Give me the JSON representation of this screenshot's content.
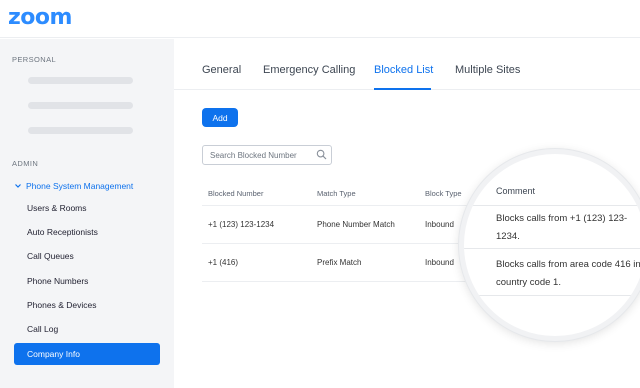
{
  "app": {
    "logo_text": "zoom"
  },
  "sidebar": {
    "personal_label": "PERSONAL",
    "admin_label": "ADMIN",
    "group": {
      "label": "Phone System Management",
      "icon": "chevron-down-icon"
    },
    "items": [
      {
        "label": "Users & Rooms"
      },
      {
        "label": "Auto Receptionists"
      },
      {
        "label": "Call Queues"
      },
      {
        "label": "Phone Numbers"
      },
      {
        "label": "Phones & Devices"
      },
      {
        "label": "Call Log"
      },
      {
        "label": "Company Info",
        "active": true
      }
    ]
  },
  "tabs": [
    {
      "label": "General"
    },
    {
      "label": "Emergency Calling"
    },
    {
      "label": "Blocked List",
      "active": true
    },
    {
      "label": "Multiple Sites"
    }
  ],
  "toolbar": {
    "add_label": "Add"
  },
  "search": {
    "placeholder": "Search Blocked Number",
    "icon": "search-icon"
  },
  "table": {
    "headers": [
      "Blocked Number",
      "Match Type",
      "Block Type",
      "Comment"
    ],
    "rows": [
      {
        "number": "+1 (123) 123-1234",
        "match": "Phone Number Match",
        "block": "Inbound",
        "comment": "Blocks calls from +1 (123) 123-1234."
      },
      {
        "number": "+1 (416)",
        "match": "Prefix Match",
        "block": "Inbound",
        "comment": "Blocks calls from area code 416 in country code 1."
      }
    ]
  },
  "colors": {
    "accent": "#0e72ed",
    "logo": "#2d8cff",
    "sidebar_bg": "#f4f5f7"
  }
}
